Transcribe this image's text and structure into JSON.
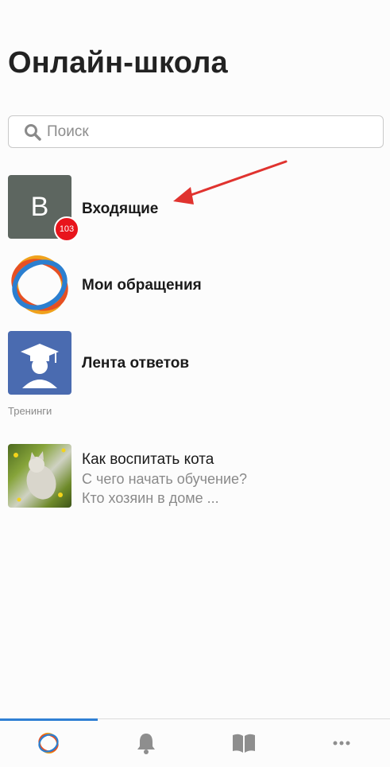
{
  "header": {
    "title": "Онлайн-школа"
  },
  "search": {
    "placeholder": "Поиск"
  },
  "chats": [
    {
      "avatar_letter": "В",
      "title": "Входящие",
      "badge": "103"
    },
    {
      "title": "Мои обращения"
    },
    {
      "title": "Лента ответов"
    }
  ],
  "trainings": {
    "label": "Тренинги",
    "items": [
      {
        "title": "Как воспитать кота",
        "line1": "С чего начать обучение?",
        "line2": "Кто хозяин в доме ..."
      }
    ]
  },
  "tabbar": {
    "tabs": [
      {
        "icon": "chats-logo-icon",
        "active": true
      },
      {
        "icon": "bell-icon",
        "active": false
      },
      {
        "icon": "book-icon",
        "active": false
      },
      {
        "icon": "more-icon",
        "active": false
      }
    ]
  },
  "colors": {
    "accent": "#2f7fd4",
    "badge": "#e8141c",
    "arrow": "#e0332f"
  }
}
